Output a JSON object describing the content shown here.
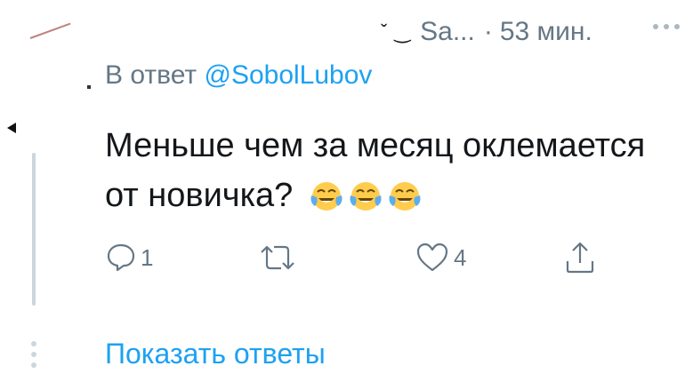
{
  "tweet_header": {
    "name_cut": "ˇ ‿",
    "handle_truncated": "Sa...",
    "separator": "·",
    "time": "53 мин."
  },
  "reply_to": {
    "prefix": "В ответ",
    "mention": "@SobolLubov"
  },
  "tweet": {
    "text": "Меньше чем за месяц оклемается от новичка?",
    "emoji": [
      "face-with-tears-of-joy",
      "face-with-tears-of-joy",
      "face-with-tears-of-joy"
    ]
  },
  "actions": {
    "reply_count": "1",
    "retweet_count": "",
    "like_count": "4"
  },
  "show_replies": "Показать ответы",
  "colors": {
    "text": "#14171a",
    "secondary": "#657786",
    "accent": "#1da1f2",
    "thread_line": "#ccd6dd",
    "emoji_face": "#ffcc4d",
    "emoji_tears": "#5dadec"
  }
}
